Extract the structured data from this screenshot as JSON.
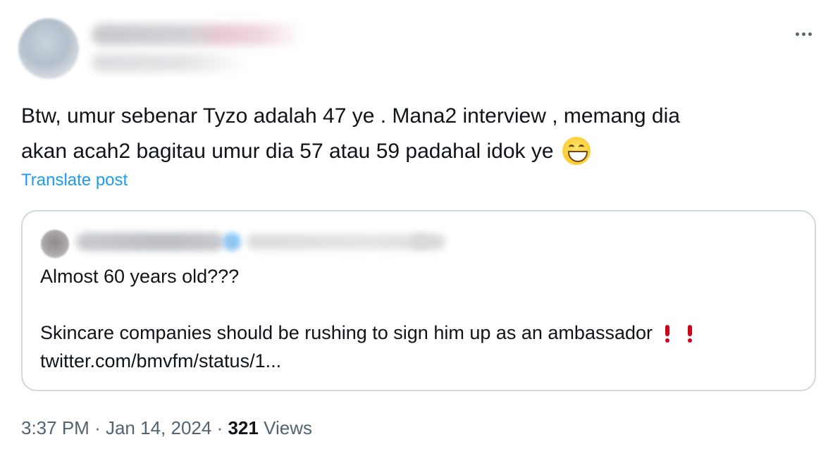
{
  "post": {
    "text_lines": [
      "Btw, umur sebenar Tyzo adalah 47 ye . Mana2 interview , memang dia",
      "akan acah2 bagitau umur dia 57 atau 59 padahal idok ye"
    ],
    "emoji": "grinning-face-with-smiling-eyes",
    "translate_label": "Translate post",
    "more_icon": "ellipsis-icon"
  },
  "quote": {
    "text_lines": [
      "Almost 60 years old???",
      "",
      "Skincare companies should be rushing to sign him up as an ambassador",
      "twitter.com/bmvfm/status/1..."
    ],
    "emoji_after_line_3": "double-exclamation-red"
  },
  "meta": {
    "time": "3:37 PM",
    "separator": "·",
    "date": "Jan 14, 2024",
    "views_count": "321",
    "views_label": "Views"
  },
  "colors": {
    "text": "#0f1419",
    "secondary": "#536471",
    "link": "#1d9bf0",
    "border": "#cfd9de",
    "exclamation": "#d0021b"
  }
}
